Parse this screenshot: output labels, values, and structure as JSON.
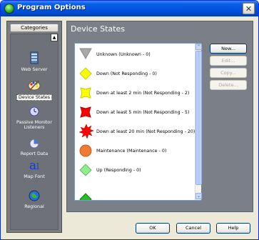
{
  "window": {
    "title": "Program Options"
  },
  "sidebar": {
    "header": "Categories",
    "items": [
      {
        "label": "Web Server",
        "icon": "web-server-icon"
      },
      {
        "label": "Device States",
        "icon": "palette-icon",
        "selected": true
      },
      {
        "label": "Passive Monitor Listeners",
        "icon": "passive-monitor-icon"
      },
      {
        "label": "Report Data",
        "icon": "report-data-icon"
      },
      {
        "label": "Map Font",
        "icon": "map-font-icon"
      },
      {
        "label": "Regional",
        "icon": "regional-icon"
      }
    ]
  },
  "main": {
    "title": "Device States",
    "states": [
      {
        "label": "Unknown  (Unknown - 0)",
        "icon": "gray-down-triangle-icon",
        "color": "#a8a8a8"
      },
      {
        "label": "Down  (Not Responding - 0)",
        "icon": "yellow-diamond-icon",
        "color": "#ffff00"
      },
      {
        "label": "Down at least 2 min  (Not Responding - 2)",
        "icon": "yellow-square-icon",
        "color": "#ffff00"
      },
      {
        "label": "Down at least 5 min  (Not Responding - 5)",
        "icon": "red-square-icon",
        "color": "#ff0000"
      },
      {
        "label": "Down at least 20 min  (Not Responding - 20)",
        "icon": "red-starburst-icon",
        "color": "#ff0000"
      },
      {
        "label": "Maintenance  (Maintenance - 0)",
        "icon": "orange-circle-icon",
        "color": "#f07a32"
      },
      {
        "label": "Up  (Responding - 0)",
        "icon": "green-diamond-icon",
        "color": "#90ee90"
      }
    ],
    "buttons": {
      "new": "New...",
      "edit": "Edit...",
      "copy": "Copy...",
      "delete": "Delete..."
    }
  },
  "footer": {
    "ok": "OK",
    "cancel": "Cancel",
    "help": "Help"
  }
}
